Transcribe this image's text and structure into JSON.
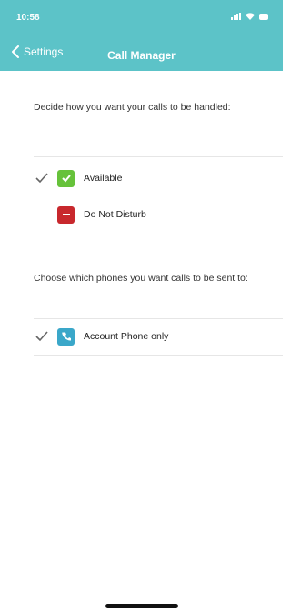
{
  "status": {
    "time": "10:58"
  },
  "nav": {
    "back_label": "Settings",
    "title": "Call Manager"
  },
  "handling": {
    "prompt": "Decide how you want your calls to be handled:",
    "options": [
      {
        "label": "Available",
        "selected": true,
        "icon": "check-icon",
        "color": "#66c23a"
      },
      {
        "label": "Do Not Disturb",
        "selected": false,
        "icon": "minus-icon",
        "color": "#c8282d"
      }
    ]
  },
  "phones": {
    "prompt": "Choose which phones you want calls to be sent to:",
    "options": [
      {
        "label": "Account Phone only",
        "selected": true,
        "icon": "phone-icon",
        "color": "#3aa7c9"
      }
    ]
  },
  "colors": {
    "header": "#5cc3c8"
  }
}
